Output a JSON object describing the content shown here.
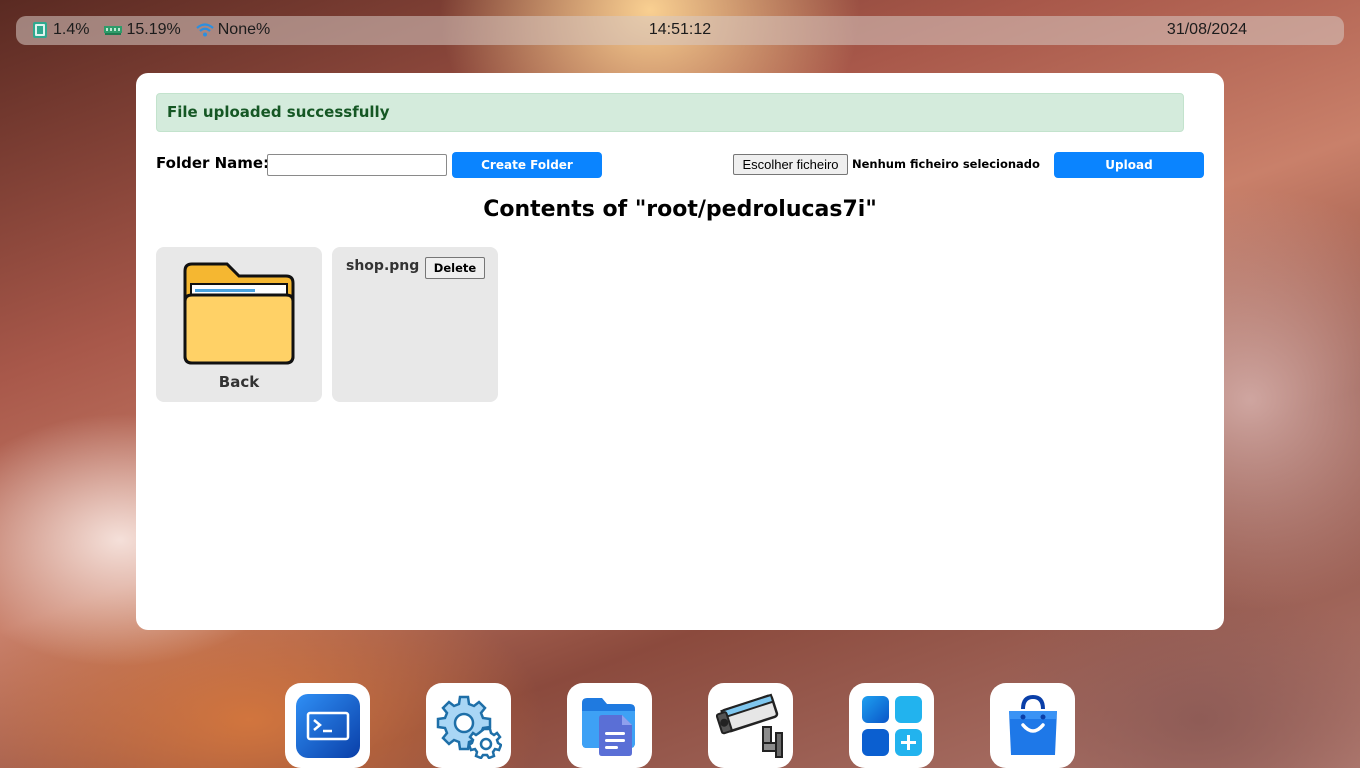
{
  "status_bar": {
    "cpu": "1.4%",
    "ram": "15.19%",
    "wifi": "None%",
    "time": "14:51:12",
    "date": "31/08/2024",
    "icons": [
      "cpu-icon",
      "ram-icon",
      "wifi-icon"
    ]
  },
  "file_manager": {
    "alert": "File uploaded successfully",
    "folder_label": "Folder Name:",
    "folder_input_value": "",
    "create_button": "Create Folder",
    "file_chooser_button": "Escolher ficheiro",
    "file_chooser_status": "Nenhum ficheiro selecionado",
    "upload_button": "Upload",
    "heading": "Contents of \"root/pedrolucas7i\"",
    "items": [
      {
        "label": "Back",
        "icon": "folder-icon"
      },
      {
        "label": "shop.png",
        "action": "Delete"
      }
    ]
  },
  "dock": {
    "apps": [
      "terminal-icon",
      "settings-icon",
      "files-icon",
      "camera-icon",
      "app-store-grid-icon",
      "shop-bag-icon"
    ]
  },
  "colors": {
    "accent": "#0a84ff",
    "alert_bg": "#d4ebdc",
    "alert_text": "#155724",
    "tile_bg": "#e8e8e8"
  }
}
